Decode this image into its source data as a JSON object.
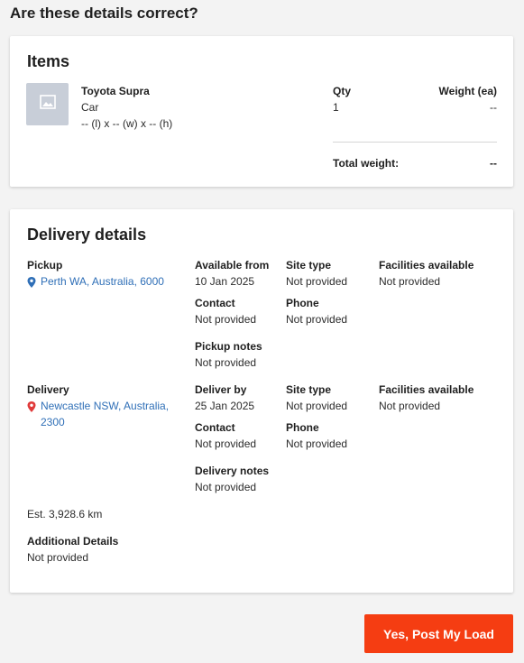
{
  "page": {
    "title": "Are these details correct?"
  },
  "items": {
    "title": "Items",
    "item": {
      "name": "Toyota Supra",
      "category": "Car",
      "dimensions": "-- (l) x -- (w) x -- (h)",
      "thumbnail_icon": "image-placeholder-icon"
    },
    "qty_label": "Qty",
    "qty_value": "1",
    "weight_label": "Weight (ea)",
    "weight_value": "--",
    "total_weight_label": "Total weight:",
    "total_weight_value": "--"
  },
  "delivery": {
    "title": "Delivery details",
    "pickup": {
      "label": "Pickup",
      "location": "Perth WA, Australia, 6000",
      "available_label": "Available from",
      "available_value": "10 Jan 2025",
      "site_type_label": "Site type",
      "site_type_value": "Not provided",
      "facilities_label": "Facilities available",
      "facilities_value": "Not provided",
      "contact_label": "Contact",
      "contact_value": "Not provided",
      "phone_label": "Phone",
      "phone_value": "Not provided",
      "notes_label": "Pickup notes",
      "notes_value": "Not provided"
    },
    "dropoff": {
      "label": "Delivery",
      "location_line1": "Newcastle NSW, Australia,",
      "location_line2": "2300",
      "deliver_by_label": "Deliver by",
      "deliver_by_value": "25 Jan 2025",
      "site_type_label": "Site type",
      "site_type_value": "Not provided",
      "facilities_label": "Facilities available",
      "facilities_value": "Not provided",
      "contact_label": "Contact",
      "contact_value": "Not provided",
      "phone_label": "Phone",
      "phone_value": "Not provided",
      "notes_label": "Delivery notes",
      "notes_value": "Not provided"
    },
    "distance": "Est. 3,928.6 km",
    "additional_label": "Additional Details",
    "additional_value": "Not provided"
  },
  "actions": {
    "post_button": "Yes, Post My Load"
  },
  "colors": {
    "accent": "#f53d12",
    "link": "#2f6fb7",
    "pickup_pin": "#2f6fb7",
    "delivery_pin": "#e03a3a"
  }
}
